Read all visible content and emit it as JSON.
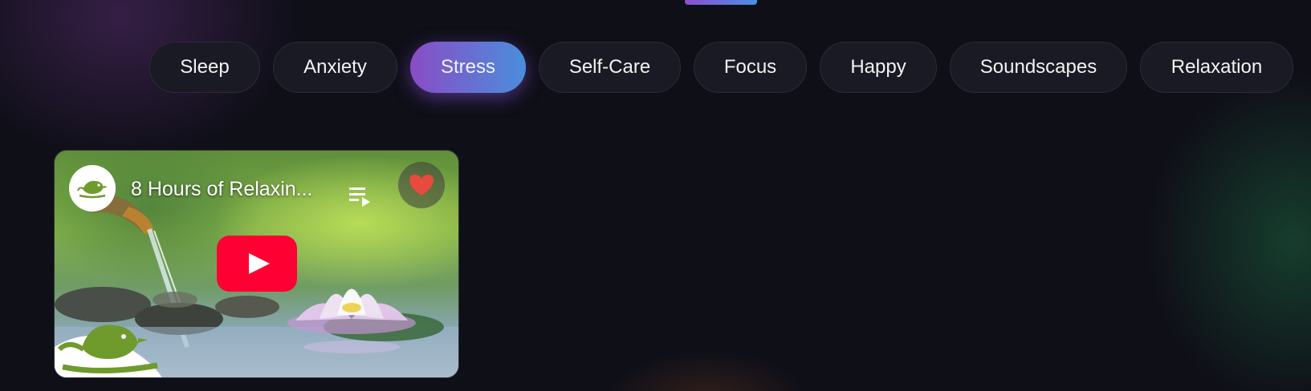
{
  "categories": [
    {
      "label": "Sleep",
      "active": false
    },
    {
      "label": "Anxiety",
      "active": false
    },
    {
      "label": "Stress",
      "active": true
    },
    {
      "label": "Self-Care",
      "active": false
    },
    {
      "label": "Focus",
      "active": false
    },
    {
      "label": "Happy",
      "active": false
    },
    {
      "label": "Soundscapes",
      "active": false
    },
    {
      "label": "Relaxation",
      "active": false
    }
  ],
  "video_card": {
    "title": "8 Hours of Relaxin...",
    "icons": {
      "channel": "bird-logo-icon",
      "playlist": "playlist-play-icon",
      "favorite": "heart-icon",
      "play": "youtube-play-icon"
    }
  },
  "colors": {
    "active_tab_start": "#8a4cc4",
    "active_tab_end": "#4a8edc",
    "heart": "#e84a3e",
    "youtube_red": "#ff0033",
    "bird_green": "#6f9a2c"
  }
}
